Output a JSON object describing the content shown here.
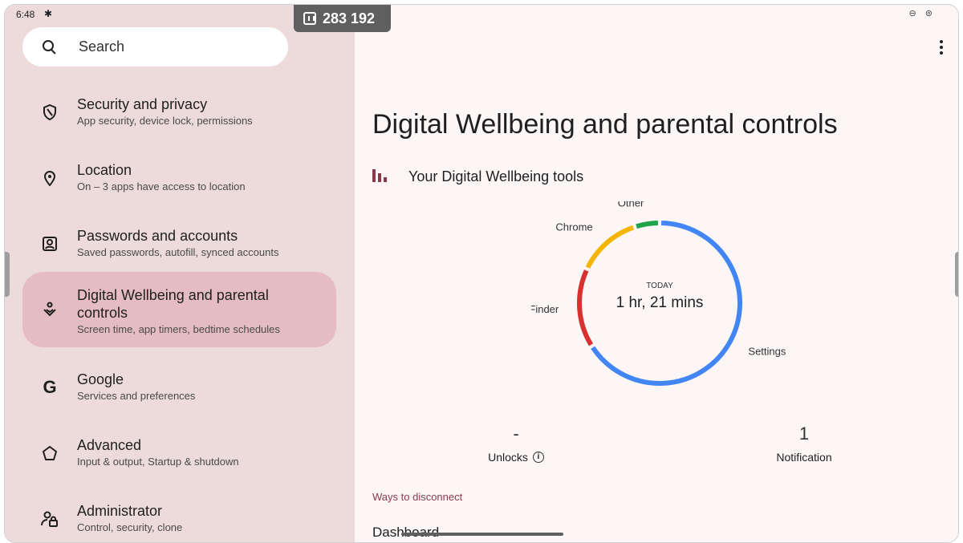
{
  "status_bar": {
    "time": "6:48",
    "right_icons": "⊖ ⊚"
  },
  "coord_badge": {
    "text": "283 192"
  },
  "search": {
    "placeholder": "Search"
  },
  "sidebar": {
    "items": [
      {
        "title": "Security and privacy",
        "subtitle": "App security, device lock, permissions",
        "icon": "shield-icon"
      },
      {
        "title": "Location",
        "subtitle": "On – 3 apps have access to location",
        "icon": "location-pin-icon"
      },
      {
        "title": "Passwords and accounts",
        "subtitle": "Saved passwords, autofill, synced accounts",
        "icon": "account-box-icon"
      },
      {
        "title": "Digital Wellbeing and parental controls",
        "subtitle": "Screen time, app timers, bedtime schedules",
        "icon": "wellbeing-icon",
        "active": true
      },
      {
        "title": "Google",
        "subtitle": "Services and preferences",
        "icon": "google-icon"
      },
      {
        "title": "Advanced",
        "subtitle": "Input & output, Startup & shutdown",
        "icon": "star-outline-icon"
      },
      {
        "title": "Administrator",
        "subtitle": "Control, security, clone",
        "icon": "admin-icon"
      }
    ]
  },
  "main": {
    "title": "Digital Wellbeing and parental controls",
    "tools_title": "Your Digital Wellbeing tools",
    "usage_today_label": "TODAY",
    "usage_today_value": "1 hr, 21 mins",
    "unlocks_value": "-",
    "unlocks_label": "Unlocks",
    "notifications_value": "1",
    "notifications_label": "Notification",
    "section_header": "Ways to disconnect",
    "dashboard_label": "Dashboard"
  },
  "chart_data": {
    "type": "pie",
    "series": [
      {
        "name": "Settings",
        "value": 66,
        "color": "#4285f4"
      },
      {
        "name": "Finder",
        "value": 16,
        "color": "#d93030"
      },
      {
        "name": "Chrome",
        "value": 13,
        "color": "#f4b400"
      },
      {
        "name": "Other",
        "value": 5,
        "color": "#1ea44a"
      }
    ]
  },
  "colors": {
    "accent": "#8a3a4a",
    "sidebar_bg": "#eddada",
    "active_item_bg": "#e4bcc1"
  }
}
